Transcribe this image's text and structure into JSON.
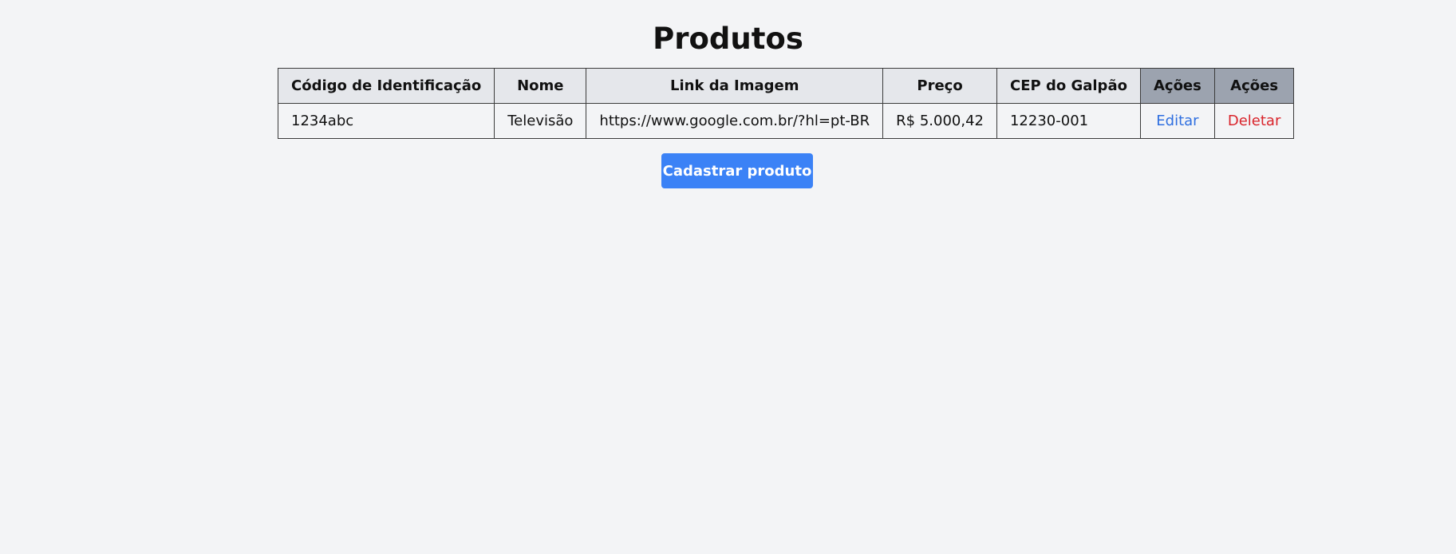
{
  "page": {
    "title": "Produtos"
  },
  "table": {
    "headers": {
      "codigo": "Código de Identificação",
      "nome": "Nome",
      "link": "Link da Imagem",
      "preco": "Preço",
      "cep": "CEP do Galpão",
      "acoes_1": "Ações",
      "acoes_2": "Ações"
    },
    "rows": [
      {
        "codigo": "1234abc",
        "nome": "Televisão",
        "link": "https://www.google.com.br/?hl=pt-BR",
        "preco": "R$ 5.000,42",
        "cep": "12230-001",
        "edit_label": "Editar",
        "delete_label": "Deletar"
      }
    ]
  },
  "actions": {
    "register_label": "Cadastrar produto"
  },
  "colors": {
    "background": "#f3f4f6",
    "header_bg": "#e5e7eb",
    "actions_header_bg": "#9ca3af",
    "primary_button": "#3b82f6",
    "edit_link": "#2f6fe0",
    "delete_link": "#d9242b"
  }
}
